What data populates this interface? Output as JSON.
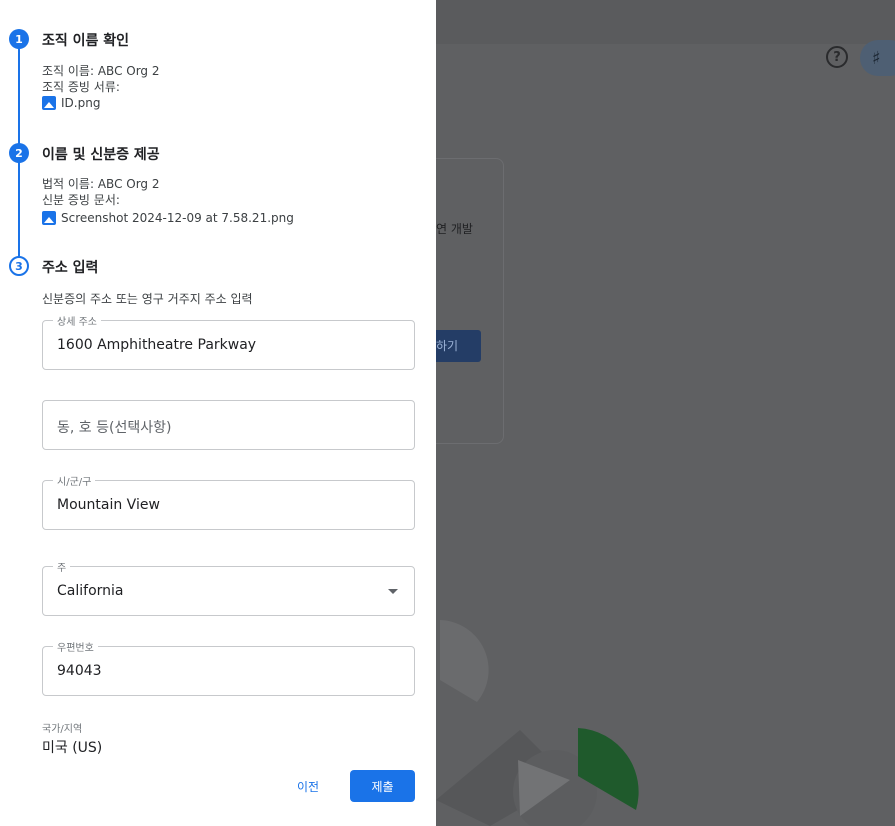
{
  "background": {
    "card_text": "연 개발",
    "card_button_label": "하기",
    "help_icon": "help-circle-icon",
    "bell_icon": "notifications-icon"
  },
  "stepper": {
    "steps": [
      {
        "number": "1",
        "title": "조직 이름 확인",
        "lines": [
          "조직 이름: ABC Org 2",
          "조직 증빙 서류:"
        ],
        "file": "ID.png",
        "status": "completed"
      },
      {
        "number": "2",
        "title": "이름 및 신분증 제공",
        "lines": [
          "법적 이름: ABC Org 2",
          "신분 증빙 문서:"
        ],
        "file": "Screenshot 2024-12-09 at 7.58.21.png",
        "status": "completed"
      },
      {
        "number": "3",
        "title": "주소 입력",
        "status": "current"
      }
    ]
  },
  "address_form": {
    "description": "신분증의 주소 또는 영구 거주지 주소 입력",
    "street": {
      "label": "상세 주소",
      "value": "1600 Amphitheatre Parkway"
    },
    "unit": {
      "placeholder": "동, 호 등(선택사항)",
      "value": ""
    },
    "city": {
      "label": "시/군/구",
      "value": "Mountain View"
    },
    "state": {
      "label": "주",
      "value": "California"
    },
    "postal": {
      "label": "우편번호",
      "value": "94043"
    },
    "country": {
      "label": "국가/지역",
      "value": "미국 (US)"
    }
  },
  "actions": {
    "prev_label": "이전",
    "submit_label": "제출"
  },
  "colors": {
    "accent": "#1a73e8",
    "overlay": "#5f6062"
  }
}
